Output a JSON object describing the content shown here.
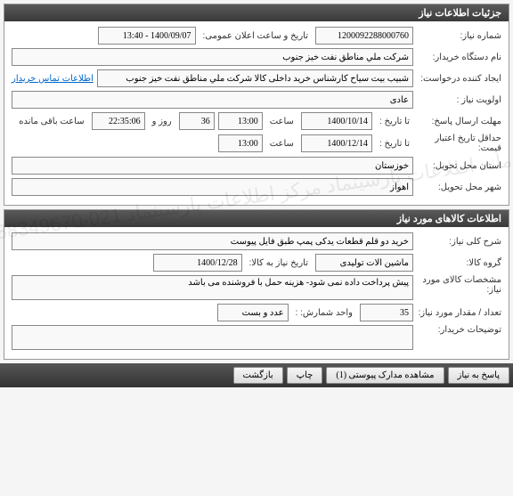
{
  "panel1": {
    "title": "جزئیات اطلاعات نیاز",
    "need_number_label": "شماره نیاز:",
    "need_number": "1200092288000760",
    "public_datetime_label": "تاریخ و ساعت اعلان عمومی:",
    "public_datetime": "1400/09/07 - 13:40",
    "buyer_org_label": "نام دستگاه خریدار:",
    "buyer_org": "شرکت ملي مناطق نفت خيز جنوب",
    "creator_label": "ایجاد کننده درخواست:",
    "creator": "شبيب بيت سياح کارشناس خريد داخلی کالا شرکت ملي مناطق نفت خيز جنوب",
    "buyer_contact_link": "اطلاعات تماس خریدار",
    "priority_label": "اولویت نیاز :",
    "priority": "عادی",
    "response_deadline_label": "مهلت ارسال پاسخ:",
    "to_date_label": "تا تاریخ :",
    "response_date": "1400/10/14",
    "time_label": "ساعت",
    "response_time": "13:00",
    "days_remaining": "36",
    "days_label": "روز و",
    "time_remaining": "22:35:06",
    "remaining_label": "ساعت باقی مانده",
    "min_validity_label": "حداقل تاریخ اعتبار قیمت:",
    "validity_date": "1400/12/14",
    "validity_time": "13:00",
    "delivery_province_label": "استان محل تحویل:",
    "delivery_province": "خوزستان",
    "delivery_city_label": "شهر محل تحویل:",
    "delivery_city": "اهواز"
  },
  "panel2": {
    "title": "اطلاعات کالاهای مورد نیاز",
    "desc_label": "شرح کلی نیاز:",
    "desc": "خرید دو قلم قطعات یدکی پمپ طبق فایل پیوست",
    "group_label": "گروه کالا:",
    "group": "ماشین آلات تولیدی",
    "need_date_label": "تاریخ نیاز به کالا:",
    "need_date": "1400/12/28",
    "specs_label": "مشخصات کالای مورد نیاز:",
    "specs": "پیش پرداخت داده نمی شود- هزینه حمل با فروشنده می باشد",
    "qty_label": "تعداد / مقدار مورد نیاز:",
    "qty": "35",
    "unit_label": "واحد شمارش: :",
    "unit": "عدد و بست",
    "buyer_notes_label": "توضیحات خریدار:"
  },
  "buttons": {
    "reply": "پاسخ به نیاز",
    "attachments": "مشاهده مدارک پیوستی (1)",
    "print": "چاپ",
    "back": "بازگشت"
  },
  "watermark": "سامانه اطلاعات پارسینماد\nمرکز اطلاعات پارسینماد\n021-88349670-5"
}
